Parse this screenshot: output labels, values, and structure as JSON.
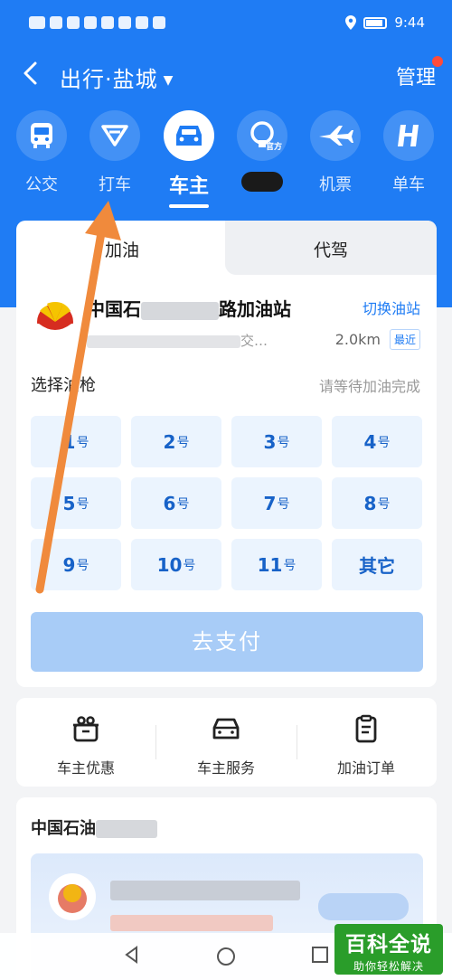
{
  "status_bar": {
    "time": "9:44"
  },
  "header": {
    "title": "出行·盐城",
    "manage": "管理"
  },
  "modes": [
    {
      "label": "公交",
      "icon": "bus-icon"
    },
    {
      "label": "打车",
      "icon": "taxi-icon"
    },
    {
      "label": "车主",
      "icon": "car-icon"
    },
    {
      "label": "",
      "icon": "rail-official-icon"
    },
    {
      "label": "机票",
      "icon": "plane-icon"
    },
    {
      "label": "单车",
      "icon": "bike-icon"
    }
  ],
  "official_badge": "官方",
  "card": {
    "tabs": [
      "加油",
      "代驾"
    ],
    "station": {
      "name_prefix": "中国石",
      "name_suffix": "路加油站",
      "switch": "切换油站",
      "address_tail": "交…",
      "distance": "2.0km",
      "badge": "最近"
    },
    "pick_title": "选择油枪",
    "pick_hint": "请等待加油完成",
    "nozzles": [
      {
        "num": "1",
        "unit": "号"
      },
      {
        "num": "2",
        "unit": "号"
      },
      {
        "num": "3",
        "unit": "号"
      },
      {
        "num": "4",
        "unit": "号"
      },
      {
        "num": "5",
        "unit": "号"
      },
      {
        "num": "6",
        "unit": "号"
      },
      {
        "num": "7",
        "unit": "号"
      },
      {
        "num": "8",
        "unit": "号"
      },
      {
        "num": "9",
        "unit": "号"
      },
      {
        "num": "10",
        "unit": "号"
      },
      {
        "num": "11",
        "unit": "号"
      },
      {
        "num": "其它",
        "unit": ""
      }
    ],
    "pay_button": "去支付"
  },
  "services": [
    {
      "label": "车主优惠",
      "icon": "gift-icon"
    },
    {
      "label": "车主服务",
      "icon": "car-service-icon"
    },
    {
      "label": "加油订单",
      "icon": "clipboard-icon"
    }
  ],
  "promo": {
    "title": "中国石油"
  },
  "watermark": {
    "big": "百科全说",
    "small": "助你轻松解决"
  },
  "colors": {
    "primary": "#1f7cf4",
    "pay_disabled": "#a8ccf7",
    "nozzle_bg": "#ebf4fe",
    "arrow": "#f08a3c"
  }
}
